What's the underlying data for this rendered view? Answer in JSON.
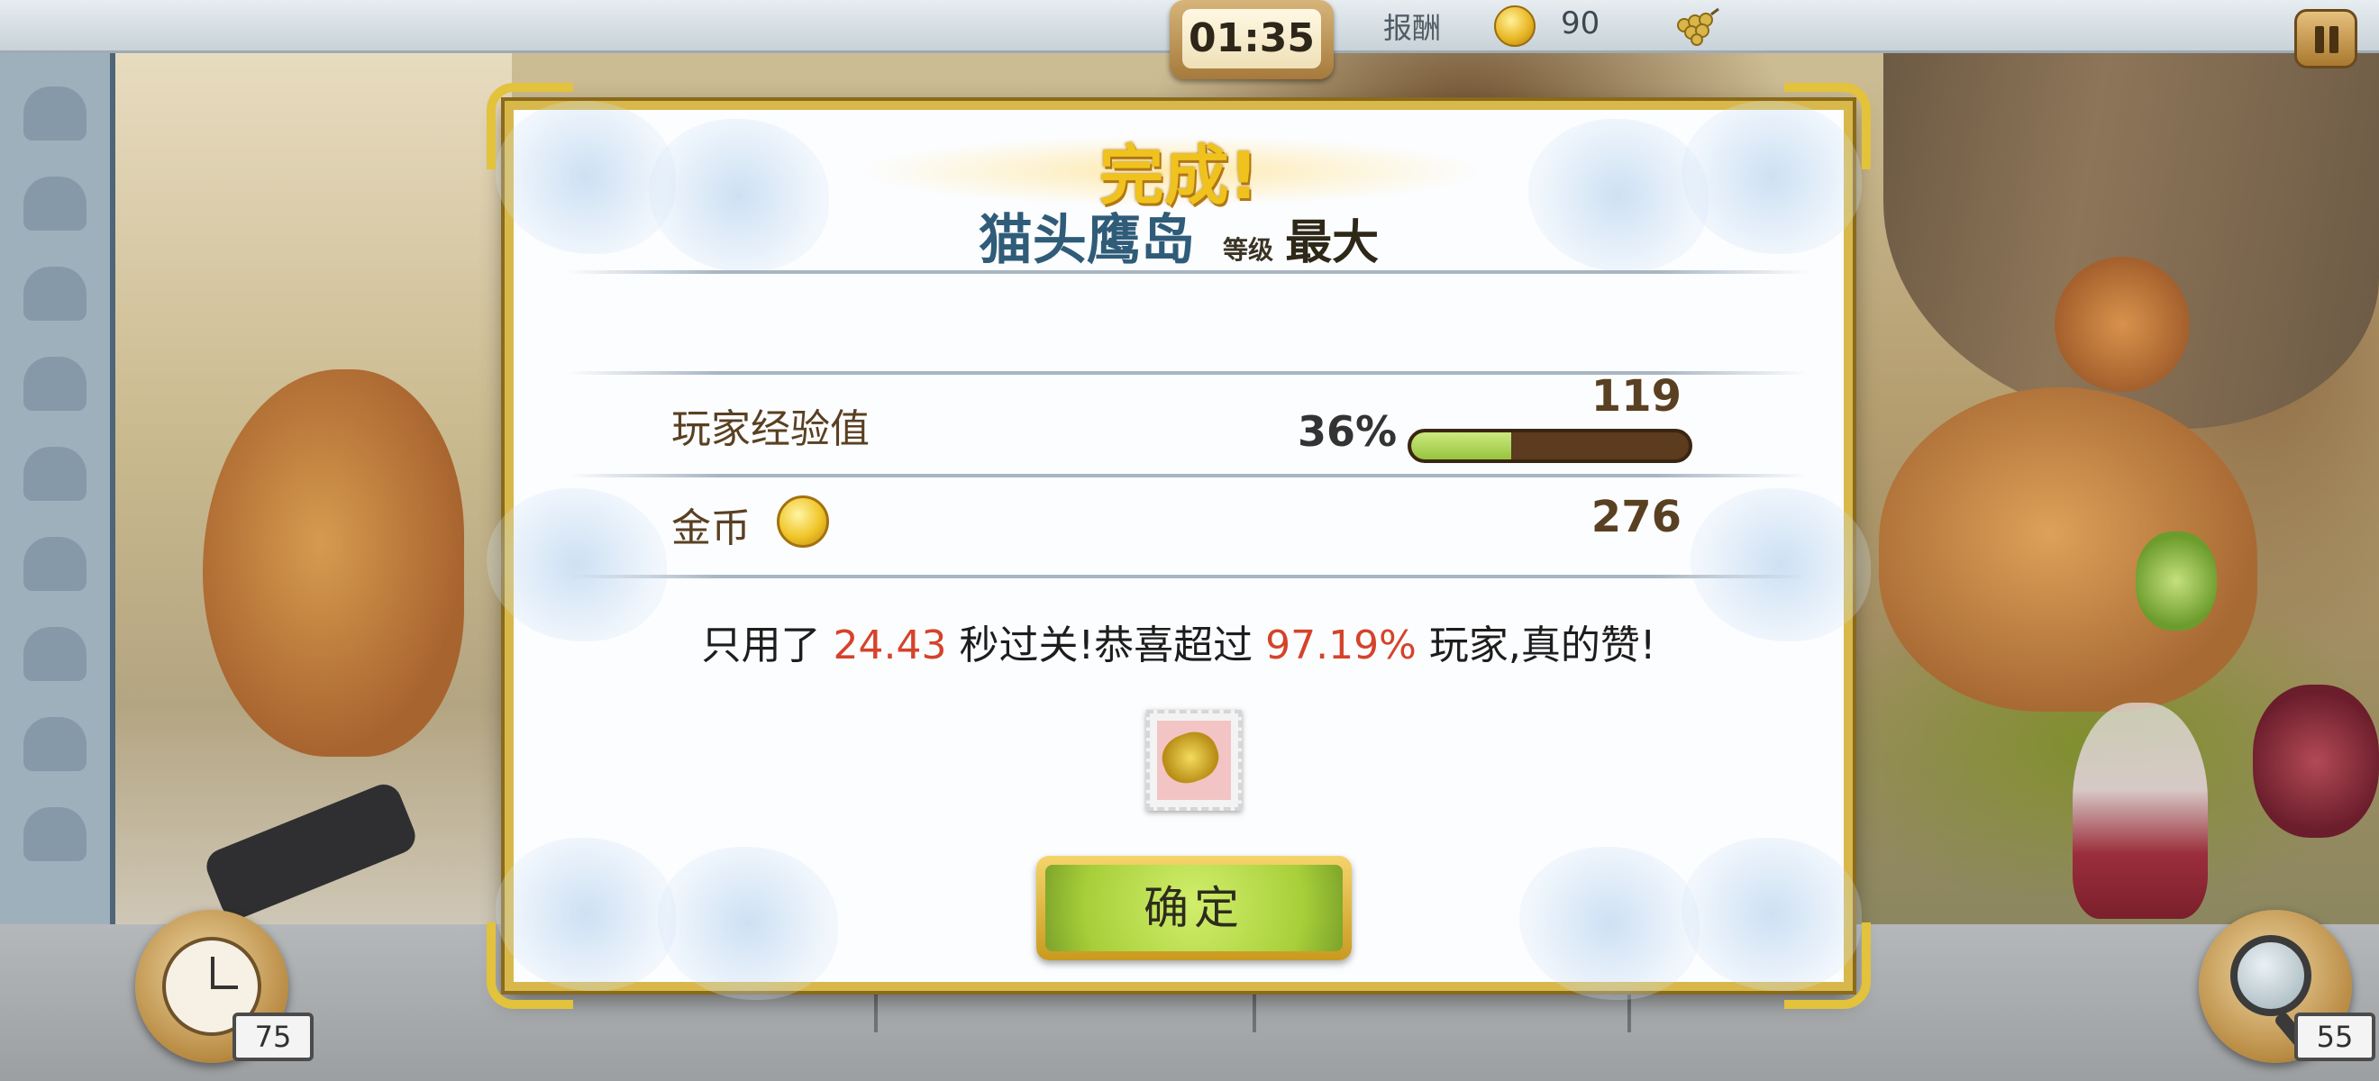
{
  "topbar": {
    "timer": "01:35",
    "reward_label": "报酬",
    "coins": "90",
    "coin_icon": "coin-icon",
    "grape_icon": "grape-icon",
    "pause_icon": "pause-icon"
  },
  "dialog": {
    "title": "完成!",
    "island_name": "猫头鹰岛",
    "level_label": "等级",
    "level_value": "最大",
    "exp": {
      "label": "玩家经验值",
      "value": "119",
      "percent_text": "36%",
      "progress_percent": 36
    },
    "gold": {
      "label": "金币",
      "value": "276"
    },
    "message": {
      "part1": "只用了",
      "time": "24.43",
      "part2": "秒过关!恭喜超过",
      "percentile": "97.19%",
      "part3": "玩家,真的赞!"
    },
    "reward_stamp_icon": "grape-stamp-icon",
    "ok_label": "确定"
  },
  "tools": {
    "clock_count": "75",
    "magnifier_count": "55"
  },
  "colors": {
    "frame_gold": "#d8b84a",
    "title_gold": "#f0c21e",
    "island_blue": "#2f5c78",
    "highlight_red": "#d5432a",
    "button_green": "#a7cf39"
  }
}
